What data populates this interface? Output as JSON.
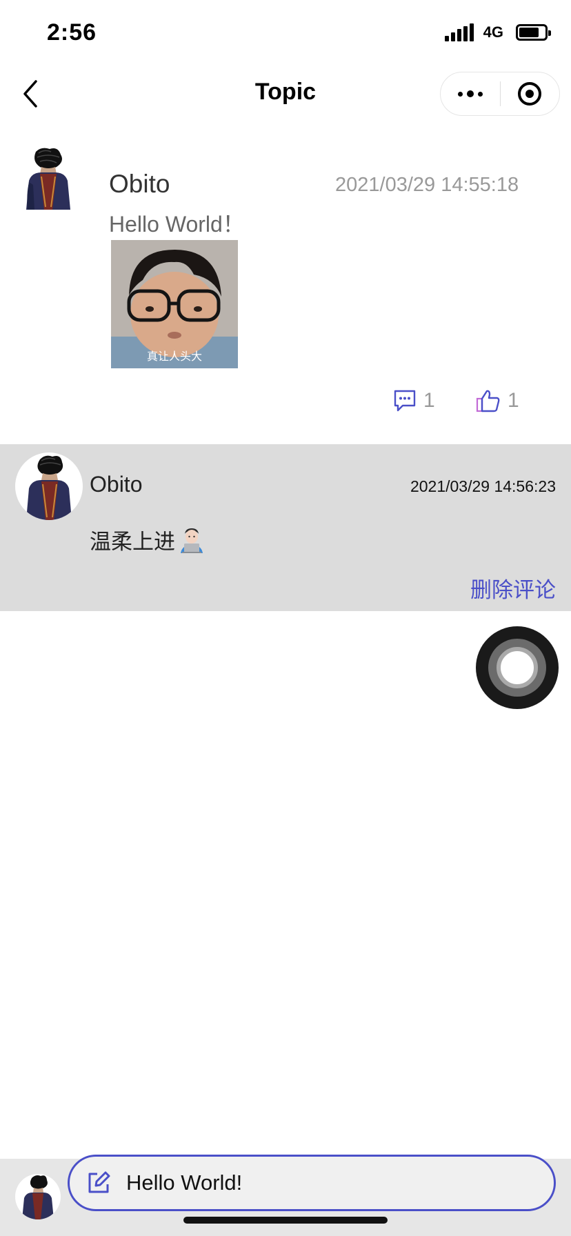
{
  "status_bar": {
    "time": "2:56",
    "network": "4G"
  },
  "nav": {
    "title": "Topic",
    "back_icon": "chevron-left-icon",
    "more_icon": "more-dots-icon",
    "close_icon": "target-circle-icon"
  },
  "post": {
    "author": "Obito",
    "timestamp": "2021/03/29 14:55:18",
    "text": "Hello World！",
    "image_caption": "真让人头大",
    "comment_count": "1",
    "like_count": "1"
  },
  "comment": {
    "author": "Obito",
    "timestamp": "2021/03/29 14:56:23",
    "text": "温柔上进",
    "delete_label": "删除评论"
  },
  "composer": {
    "value": "Hello World!"
  },
  "colors": {
    "accent": "#4a4fc8",
    "comment_bg": "#dcdcdc",
    "muted": "#999999"
  }
}
